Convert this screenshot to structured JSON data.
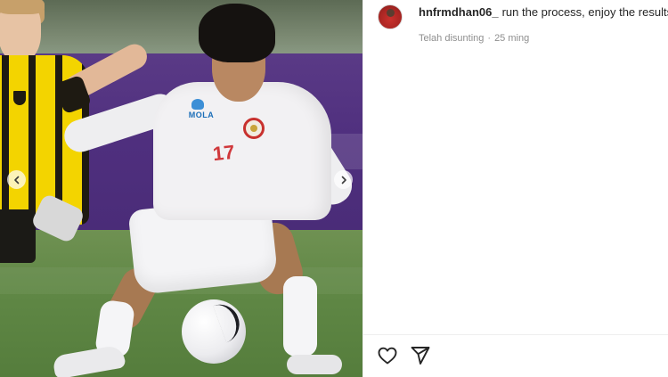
{
  "post": {
    "username": "hnfrmdhan06_",
    "caption": "run the process, enjoy the results",
    "edited_label": "Telah disunting",
    "separator": "·",
    "time_ago": "25 ming"
  },
  "media": {
    "jersey_number": "17",
    "sponsor_text": "MOLA",
    "prev_icon": "chevron-left-icon",
    "next_icon": "chevron-right-icon"
  },
  "actions": {
    "like_icon": "heart-icon",
    "share_icon": "paper-plane-icon"
  },
  "colors": {
    "jersey_number": "#d0383b",
    "hoarding": "#4f2f7e",
    "pitch": "#5f8745",
    "meta_text": "#8e8e8e",
    "text": "#262626"
  }
}
